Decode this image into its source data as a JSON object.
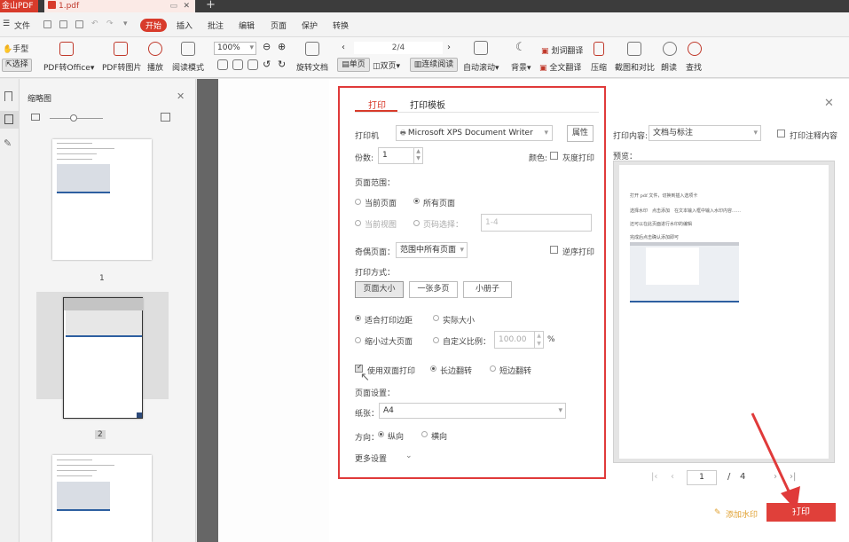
{
  "titlebar": {
    "app_name": "金山PDF",
    "doc_tab": "1.pdf"
  },
  "menubar": {
    "file": "文件",
    "items": [
      "开始",
      "插入",
      "批注",
      "编辑",
      "页面",
      "保护",
      "转换"
    ]
  },
  "toolbar": {
    "hand": "手型",
    "select": "选择",
    "pdf_to_office": "PDF转Office",
    "pdf_to_image": "PDF转图片",
    "play": "播放",
    "read_mode": "阅读模式",
    "zoom": "100%",
    "rotate_doc": "旋转文档",
    "page_indicator": "2/4",
    "single_page": "单页",
    "double_page": "双页",
    "continuous": "连续阅读",
    "auto_scroll": "自动滚动",
    "background": "背景",
    "word_translate": "划词翻译",
    "full_translate": "全文翻译",
    "compress": "压缩",
    "screenshot_compare": "截图和对比",
    "read_aloud": "朗读",
    "find": "查找"
  },
  "thumbnails": {
    "title": "缩略图",
    "pages": [
      "1",
      "2"
    ]
  },
  "dialog": {
    "tabs": [
      "打印",
      "打印模板"
    ],
    "printer_label": "打印机",
    "printer_value": "Microsoft XPS Document Writer",
    "properties": "属性",
    "copies_label": "份数:",
    "copies_value": "1",
    "color_label": "颜色:",
    "grayscale": "灰度打印",
    "page_range_label": "页面范围：",
    "current_page": "当前页面",
    "all_pages": "所有页面",
    "current_view": "当前视图",
    "page_select": "页码选择：",
    "page_select_placeholder": "1-4",
    "odd_even_label": "奇偶页面：",
    "odd_even_value": "范围中所有页面",
    "reverse": "逆序打印",
    "print_mode_label": "打印方式：",
    "mode_buttons": [
      "页面大小",
      "一张多页",
      "小册子"
    ],
    "fit_margin": "适合打印边距",
    "actual_size": "实际大小",
    "shrink_large": "缩小过大页面",
    "custom_scale": "自定义比例：",
    "custom_scale_value": "100.00",
    "percent": "%",
    "duplex": "使用双面打印",
    "long_edge": "长边翻转",
    "short_edge": "短边翻转",
    "page_setup_label": "页面设置：",
    "paper_label": "纸张：",
    "paper_value": "A4",
    "orientation_label": "方向：",
    "portrait": "纵向",
    "landscape": "横向",
    "more_settings": "更多设置",
    "print_content_label": "打印内容:",
    "print_content_value": "文档与标注",
    "print_annotations": "打印注释内容",
    "preview_label": "预览：",
    "preview_current_page": "1",
    "preview_separator": "/",
    "preview_total_pages": "4",
    "add_watermark": "添加水印",
    "print_button": "打印",
    "preview_lines": [
      "打开 pdf 文件，切换到插入选项卡",
      "选择水印　点击添加　在文本输入框中输入水印内容……",
      "还可以在此页面进行水印的编辑",
      "完成后点击确认添加即可"
    ]
  }
}
